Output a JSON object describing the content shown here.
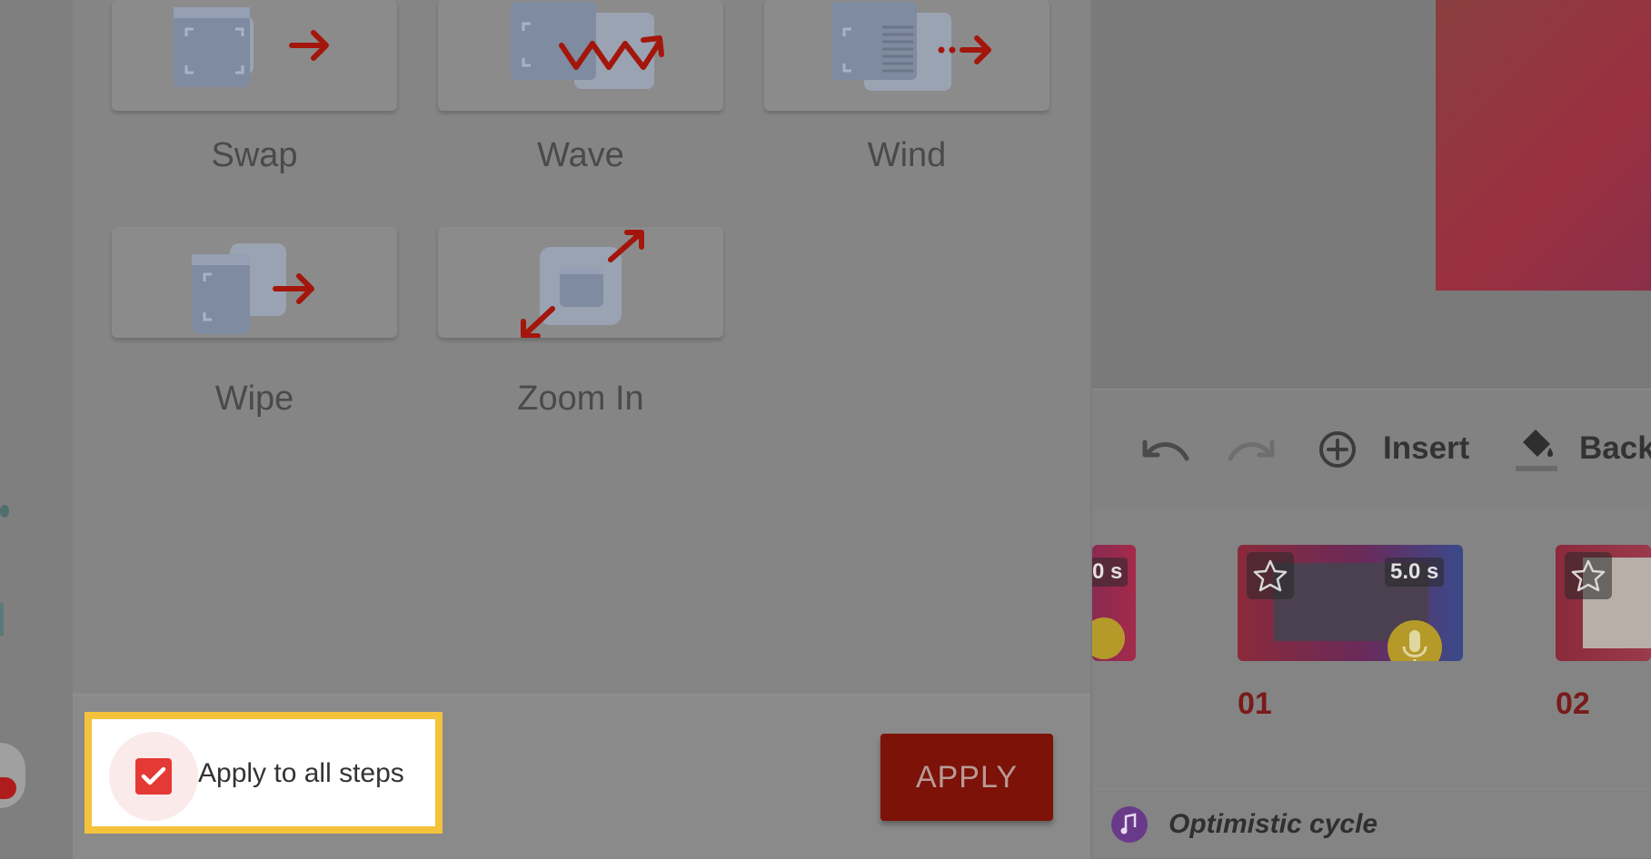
{
  "transitions": [
    {
      "label": "Swap"
    },
    {
      "label": "Wave"
    },
    {
      "label": "Wind"
    },
    {
      "label": "Wipe"
    },
    {
      "label": "Zoom In"
    }
  ],
  "footer": {
    "apply_all_label": "Apply to all steps",
    "apply_all_checked": true,
    "apply_label": "APPLY"
  },
  "toolbar": {
    "insert_label": "Insert",
    "background_label": "Back"
  },
  "timeline": {
    "steps": [
      {
        "number": "",
        "duration": "0 s"
      },
      {
        "number": "01",
        "duration": "5.0 s"
      },
      {
        "number": "02",
        "duration": ""
      }
    ]
  },
  "music": {
    "title": "Optimistic cycle"
  },
  "colors": {
    "accent": "#e53935",
    "highlight": "#f5c23c",
    "apply_button": "#7c1208"
  }
}
